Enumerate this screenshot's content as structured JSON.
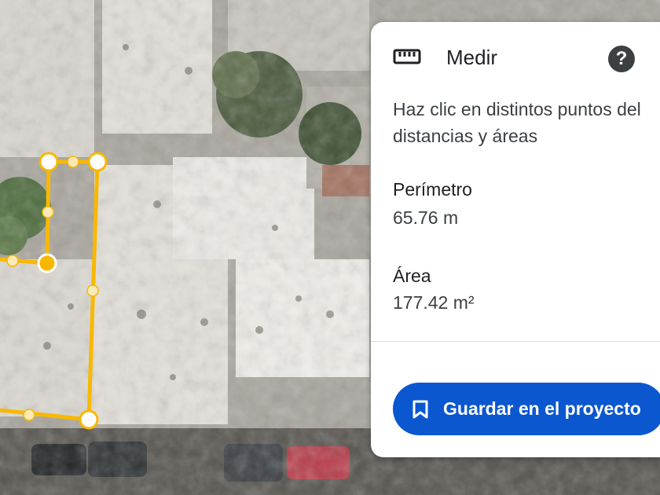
{
  "panel": {
    "title": "Medir",
    "icon": "ruler-icon",
    "help_icon": "help-icon",
    "help_glyph": "?",
    "description_line1": "Haz clic en distintos puntos del",
    "description_line2": "distancias y áreas",
    "perimeter_label": "Perímetro",
    "perimeter_value": "65.76 m",
    "area_label": "Área",
    "area_value": "177.42 m²",
    "save_button_label": "Guardar en el proyecto",
    "save_button_icon": "bookmark-icon"
  },
  "colors": {
    "measure_line": "#f9b800",
    "button_bg": "#0b57d0",
    "panel_bg": "#ffffff"
  }
}
